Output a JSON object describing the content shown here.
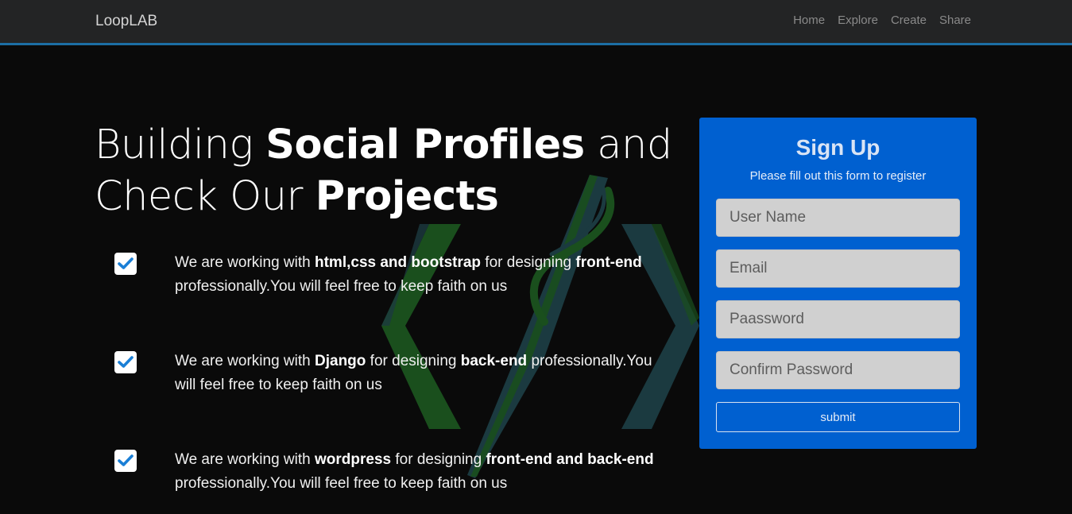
{
  "navbar": {
    "brand": "LoopLAB",
    "links": [
      "Home",
      "Explore",
      "Create",
      "Share"
    ]
  },
  "hero": {
    "line1_light": "Building ",
    "line1_strong": "Social Profiles",
    "line1_tail": " and",
    "line2_light": "Check Our ",
    "line2_strong": "Projects"
  },
  "features": [
    {
      "p1": "We are working with ",
      "b1": "html,css and bootstrap",
      "p2": " for designing ",
      "b2": "front-end",
      "p3": " professionally.You will feel free to keep faith on us"
    },
    {
      "p1": "We are working with ",
      "b1": "Django",
      "p2": " for designing ",
      "b2": "back-end",
      "p3": " professionally.You will feel free to keep faith on us"
    },
    {
      "p1": "We are working with ",
      "b1": "wordpress",
      "p2": " for designing ",
      "b2": "front-end and back-end",
      "p3": " professionally.You will feel free to keep faith on us"
    }
  ],
  "signup": {
    "title": "Sign Up",
    "subtitle": "Please fill out this form to register",
    "username_placeholder": "User Name",
    "email_placeholder": "Email",
    "password_placeholder": "Paassword",
    "confirm_placeholder": "Confirm Password",
    "submit_label": "submit"
  },
  "colors": {
    "accent_blue": "#0060d0",
    "nav_border": "#1c6ea4",
    "check_blue": "#1a7fd6",
    "logo_green": "#1a4f1d",
    "logo_teal": "#1b3a40"
  }
}
